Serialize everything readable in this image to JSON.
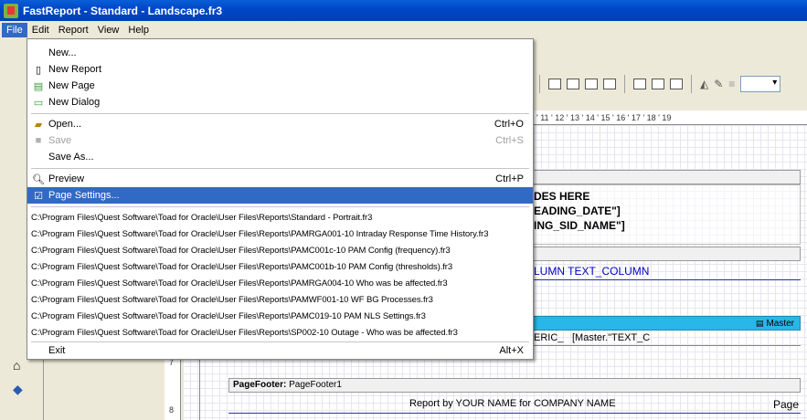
{
  "window": {
    "title": "FastReport - Standard - Landscape.fr3"
  },
  "menubar": {
    "items": [
      "File",
      "Edit",
      "Report",
      "View",
      "Help"
    ],
    "active": "File"
  },
  "file_menu": {
    "new": "New...",
    "new_report": "New Report",
    "new_page": "New Page",
    "new_dialog": "New Dialog",
    "open": "Open...",
    "open_shortcut": "Ctrl+O",
    "save": "Save",
    "save_shortcut": "Ctrl+S",
    "save_as": "Save As...",
    "preview": "Preview",
    "preview_shortcut": "Ctrl+P",
    "page_settings": "Page Settings...",
    "recent": [
      "C:\\Program Files\\Quest Software\\Toad for Oracle\\User Files\\Reports\\Standard - Portrait.fr3",
      "C:\\Program Files\\Quest Software\\Toad for Oracle\\User Files\\Reports\\PAMRGA001-10 Intraday Response Time History.fr3",
      "C:\\Program Files\\Quest Software\\Toad for Oracle\\User Files\\Reports\\PAMC001c-10 PAM Config (frequency).fr3",
      "C:\\Program Files\\Quest Software\\Toad for Oracle\\User Files\\Reports\\PAMC001b-10 PAM Config (thresholds).fr3",
      "C:\\Program Files\\Quest Software\\Toad for Oracle\\User Files\\Reports\\PAMRGA004-10 Who was be affected.fr3",
      "C:\\Program Files\\Quest Software\\Toad for Oracle\\User Files\\Reports\\PAMWF001-10 WF BG Processes.fr3",
      "C:\\Program Files\\Quest Software\\Toad for Oracle\\User Files\\Reports\\PAMC019-10 PAM NLS Settings.fr3",
      "C:\\Program Files\\Quest Software\\Toad for Oracle\\User Files\\Reports\\SP002-10 Outage - Who was be affected.fr3"
    ],
    "exit": "Exit",
    "exit_shortcut": "Alt+X"
  },
  "ruler": {
    "text": "' 11 ' 12 ' 13 ' 14 ' 15 ' 16 ' 17 ' 18 ' 19"
  },
  "vruler": {
    "marks": [
      "7",
      "8"
    ]
  },
  "report": {
    "header_lines": [
      "DES HERE",
      "EADING_DATE\"]",
      "ING_SID_NAME\"]"
    ],
    "column_text": "LUMN TEXT_COLUMN",
    "master_band_label": "Master",
    "master_row_a": "ERIC_",
    "master_row_b": "[Master.\"TEXT_C",
    "page_footer_label": "PageFooter:",
    "page_footer_name": "PageFooter1",
    "footer_text": "Report by YOUR NAME for COMPANY NAME",
    "footer_right": "Page"
  }
}
